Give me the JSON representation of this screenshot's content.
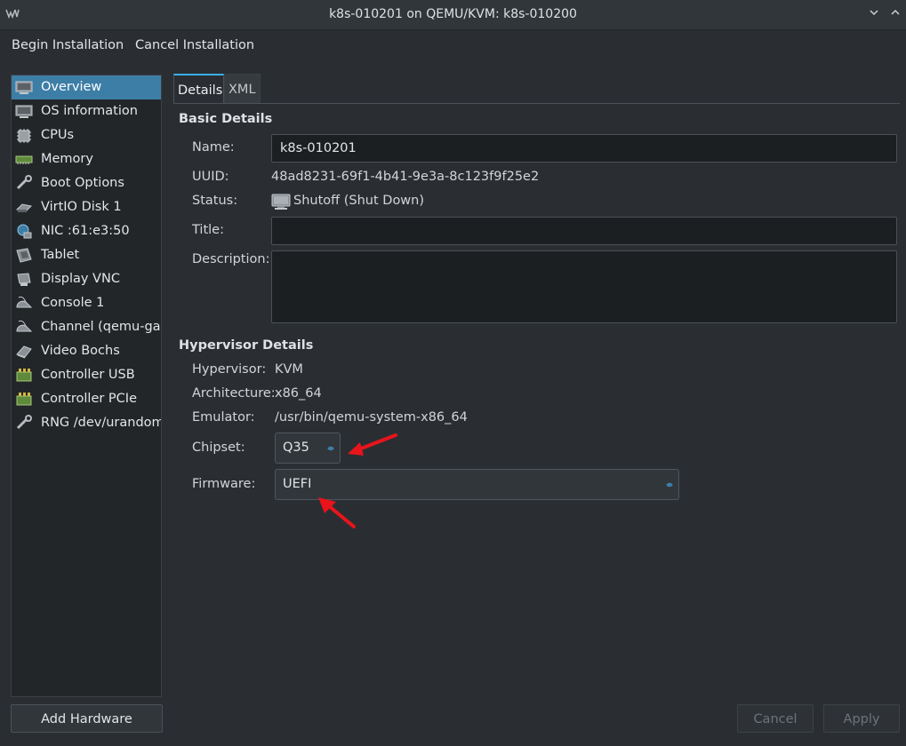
{
  "window": {
    "title": "k8s-010201 on QEMU/KVM: k8s-010200"
  },
  "menu": {
    "begin": "Begin Installation",
    "cancel": "Cancel Installation"
  },
  "sidebar": {
    "items": [
      {
        "label": "Overview",
        "icon": "monitor-icon",
        "selected": true
      },
      {
        "label": "OS information",
        "icon": "monitor-icon"
      },
      {
        "label": "CPUs",
        "icon": "cpu-icon"
      },
      {
        "label": "Memory",
        "icon": "memory-icon"
      },
      {
        "label": "Boot Options",
        "icon": "wrench-icon"
      },
      {
        "label": "VirtIO Disk 1",
        "icon": "disk-icon"
      },
      {
        "label": "NIC :61:e3:50",
        "icon": "network-icon"
      },
      {
        "label": "Tablet",
        "icon": "tablet-icon"
      },
      {
        "label": "Display VNC",
        "icon": "display-icon"
      },
      {
        "label": "Console 1",
        "icon": "console-icon"
      },
      {
        "label": "Channel (qemu-ga)",
        "icon": "channel-icon"
      },
      {
        "label": "Video Bochs",
        "icon": "video-icon"
      },
      {
        "label": "Controller USB",
        "icon": "controller-icon"
      },
      {
        "label": "Controller PCIe",
        "icon": "controller-icon"
      },
      {
        "label": "RNG /dev/urandom",
        "icon": "wrench-icon"
      }
    ],
    "add_hardware": "Add Hardware"
  },
  "tabs": {
    "details": "Details",
    "xml": "XML"
  },
  "basic": {
    "heading": "Basic Details",
    "name_label": "Name:",
    "name_value": "k8s-010201",
    "uuid_label": "UUID:",
    "uuid_value": "48ad8231-69f1-4b41-9e3a-8c123f9f25e2",
    "status_label": "Status:",
    "status_value": "Shutoff (Shut Down)",
    "title_label": "Title:",
    "title_value": "",
    "description_label": "Description:",
    "description_value": ""
  },
  "hypervisor": {
    "heading": "Hypervisor Details",
    "hypervisor_label": "Hypervisor:",
    "hypervisor_value": "KVM",
    "architecture_label": "Architecture:",
    "architecture_value": "x86_64",
    "emulator_label": "Emulator:",
    "emulator_value": "/usr/bin/qemu-system-x86_64",
    "chipset_label": "Chipset:",
    "chipset_value": "Q35",
    "firmware_label": "Firmware:",
    "firmware_value": "UEFI"
  },
  "footer": {
    "cancel": "Cancel",
    "apply": "Apply"
  },
  "colors": {
    "selection": "#3d7ea6",
    "tab_accent": "#3daee9",
    "annotation_arrow": "#e8141b"
  }
}
